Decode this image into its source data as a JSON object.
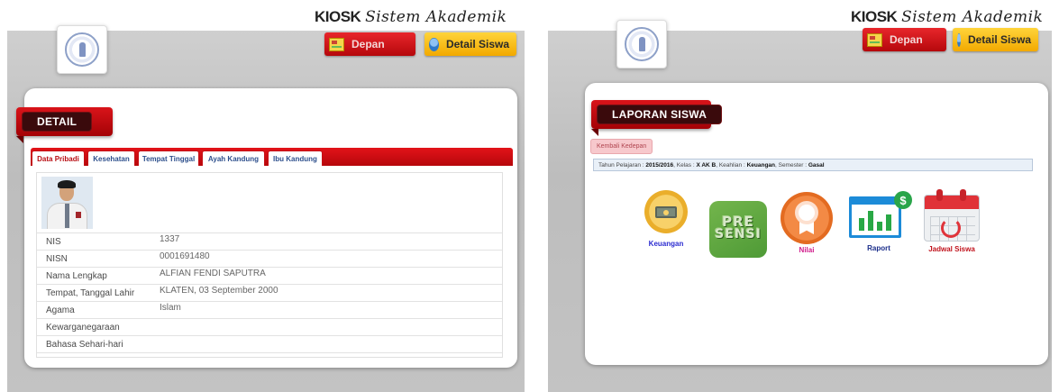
{
  "left_screen": {
    "brand_bold": "KIOSK",
    "brand_script": "Sistem Akademik",
    "nav": {
      "home_label": "Depan",
      "detail_label": "Detail Siswa"
    },
    "section_title": "DETAIL",
    "tabs": [
      "Data Pribadi",
      "Kesehatan",
      "Tempat Tinggal",
      "Ayah Kandung",
      "Ibu Kandung"
    ],
    "active_tab": "Data Pribadi",
    "rows": [
      {
        "label": "NIS",
        "value": "1337"
      },
      {
        "label": "NISN",
        "value": "0001691480"
      },
      {
        "label": "Nama Lengkap",
        "value": "ALFIAN FENDI SAPUTRA"
      },
      {
        "label": "Tempat, Tanggal Lahir",
        "value": "KLATEN, 03 September 2000"
      },
      {
        "label": "Agama",
        "value": "Islam"
      },
      {
        "label": "Kewarganegaraan",
        "value": ""
      },
      {
        "label": "Bahasa Sehari-hari",
        "value": ""
      }
    ]
  },
  "right_screen": {
    "brand_bold": "KIOSK",
    "brand_script": "Sistem Akademik",
    "nav": {
      "home_label": "Depan",
      "detail_label": "Detail Siswa"
    },
    "section_title": "LAPORAN SISWA",
    "back_button": "Kembali Kedepan",
    "info": {
      "year_label": "Tahun Pelajaran :",
      "year_value": "2015/2016",
      "class_label": ", Kelas :",
      "class_value": "X AK B",
      "major_label": ", Keahlian :",
      "major_value": "Keuangan",
      "semester_label": ", Semester :",
      "semester_value": "Gasal"
    },
    "menu": [
      {
        "label": "Keuangan",
        "color": "#2b2bd0",
        "icon": "money-icon"
      },
      {
        "label": "",
        "color": "#222222",
        "icon": "presensi-icon",
        "art_text_1": "PRE",
        "art_text_2": "SENSI"
      },
      {
        "label": "Nilai",
        "color": "#d01c8b",
        "icon": "ribbon-award-icon"
      },
      {
        "label": "Raport",
        "color": "#1a2d8a",
        "icon": "report-chart-icon"
      },
      {
        "label": "Jadwal Siswa",
        "color": "#c0121c",
        "icon": "calendar-icon"
      }
    ]
  },
  "colors": {
    "accent_red": "#c70b12",
    "accent_yellow": "#f4b000",
    "grey_bg": "#c4c4c4"
  }
}
